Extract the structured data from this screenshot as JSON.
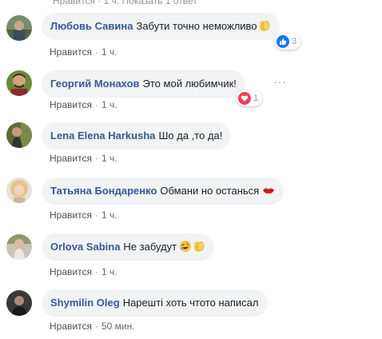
{
  "top_cut_text": "Нравится · 1 ч.   Показать 1 ответ",
  "comments": [
    {
      "author": "Любовь Савина",
      "text": "Забути точно неможливо",
      "like_label": "Нравится",
      "time": "1 ч.",
      "reaction_count": "3",
      "reaction_type": "like",
      "emoji": "clapping-hands"
    },
    {
      "author": "Георгий Монахов",
      "text": "Это мой любимчик!",
      "like_label": "Нравится",
      "time": "1 ч.",
      "reaction_count": "1",
      "reaction_type": "love"
    },
    {
      "author": "Lena Elena Harkusha",
      "text": "Шо да ,то да!",
      "like_label": "Нравится",
      "time": "1 ч."
    },
    {
      "author": "Татьяна Бондаренко",
      "text": "Обмани но останься",
      "like_label": "Нравится",
      "time": "1 ч.",
      "emoji": "lips"
    },
    {
      "author": "Orlova Sabina",
      "text": "Не забудут",
      "like_label": "Нравится",
      "time": "1 ч.",
      "emoji": "laughing-and-clapping"
    },
    {
      "author": "Shymilin Oleg",
      "text": "Нарешті хоть чтото написал",
      "like_label": "Нравится",
      "time": "50 мин."
    }
  ],
  "separator": "·",
  "more_options": "···",
  "colors": {
    "author": "#385898",
    "bubble": "#f2f3f5",
    "meta": "#616770",
    "like_reaction": "#1877f2",
    "love_reaction": "#f33e58"
  }
}
